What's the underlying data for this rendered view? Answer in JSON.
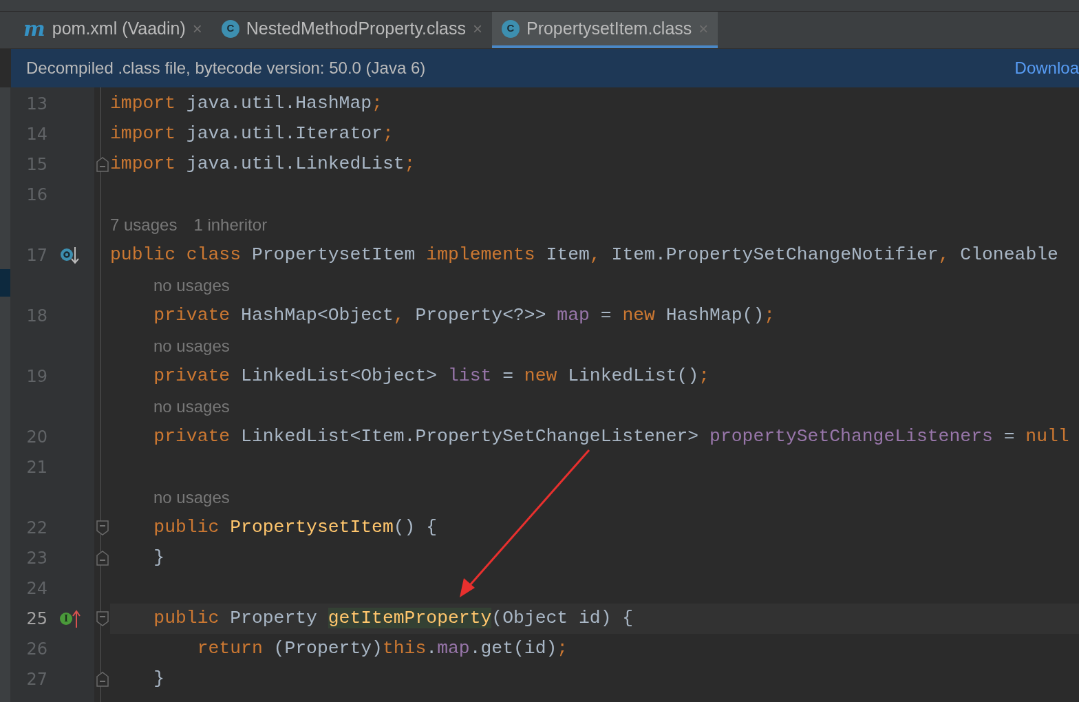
{
  "tabs": [
    {
      "kind": "maven",
      "badge": "m",
      "label": "pom.xml (Vaadin)",
      "close": "×",
      "selected": false
    },
    {
      "kind": "class",
      "badge": "C",
      "label": "NestedMethodProperty.class",
      "close": "×",
      "selected": false
    },
    {
      "kind": "class",
      "badge": "C",
      "label": "PropertysetItem.class",
      "close": "×",
      "selected": true
    }
  ],
  "banner": {
    "text": "Decompiled .class file, bytecode version: 50.0 (Java 6)",
    "link": "Downloa"
  },
  "lines": [
    {
      "kind": "code",
      "number": "13",
      "current": false,
      "tokens": [
        {
          "t": "import",
          "kind": "kw"
        },
        {
          "t": " java.util.HashMap",
          "kind": "plain"
        },
        {
          "t": ";",
          "kind": "kw"
        }
      ]
    },
    {
      "kind": "code",
      "number": "14",
      "current": false,
      "tokens": [
        {
          "t": "import",
          "kind": "kw"
        },
        {
          "t": " java.util.Iterator",
          "kind": "plain"
        },
        {
          "t": ";",
          "kind": "kw"
        }
      ]
    },
    {
      "kind": "code",
      "number": "15",
      "current": false,
      "fold": {
        "kind": "end"
      },
      "tokens": [
        {
          "t": "import",
          "kind": "kw"
        },
        {
          "t": " java.util.LinkedList",
          "kind": "plain"
        },
        {
          "t": ";",
          "kind": "kw"
        }
      ]
    },
    {
      "kind": "code",
      "number": "16",
      "current": false
    },
    {
      "kind": "class-hint",
      "hints": [
        "7 usages",
        "1 inheritor"
      ]
    },
    {
      "kind": "code",
      "number": "17",
      "current": false,
      "gutter": {
        "kind": "implemented"
      },
      "tokens": [
        {
          "t": "public class ",
          "kind": "kw"
        },
        {
          "t": "PropertysetItem ",
          "kind": "plain"
        },
        {
          "t": "implements ",
          "kind": "kw"
        },
        {
          "t": "Item",
          "kind": "plain"
        },
        {
          "t": ", ",
          "kind": "kw"
        },
        {
          "t": "Item.PropertySetChangeNotifier",
          "kind": "plain"
        },
        {
          "t": ", ",
          "kind": "kw"
        },
        {
          "t": "Cloneable",
          "kind": "plain"
        }
      ]
    },
    {
      "kind": "member-hint",
      "hints": [
        "no usages"
      ]
    },
    {
      "kind": "code",
      "number": "18",
      "current": false,
      "tokens": [
        {
          "t": "    private ",
          "kind": "kw"
        },
        {
          "t": "HashMap<Object",
          "kind": "plain"
        },
        {
          "t": ", ",
          "kind": "kw"
        },
        {
          "t": "Property<?>> ",
          "kind": "plain"
        },
        {
          "t": "map",
          "kind": "field"
        },
        {
          "t": " = ",
          "kind": "plain"
        },
        {
          "t": "new ",
          "kind": "kw"
        },
        {
          "t": "HashMap()",
          "kind": "plain"
        },
        {
          "t": ";",
          "kind": "kw"
        }
      ]
    },
    {
      "kind": "member-hint",
      "hints": [
        "no usages"
      ]
    },
    {
      "kind": "code",
      "number": "19",
      "current": false,
      "tokens": [
        {
          "t": "    private ",
          "kind": "kw"
        },
        {
          "t": "LinkedList<Object> ",
          "kind": "plain"
        },
        {
          "t": "list",
          "kind": "field"
        },
        {
          "t": " = ",
          "kind": "plain"
        },
        {
          "t": "new ",
          "kind": "kw"
        },
        {
          "t": "LinkedList()",
          "kind": "plain"
        },
        {
          "t": ";",
          "kind": "kw"
        }
      ]
    },
    {
      "kind": "member-hint",
      "hints": [
        "no usages"
      ]
    },
    {
      "kind": "code",
      "number": "20",
      "current": false,
      "tokens": [
        {
          "t": "    private ",
          "kind": "kw"
        },
        {
          "t": "LinkedList<Item.PropertySetChangeListener> ",
          "kind": "plain"
        },
        {
          "t": "propertySetChangeListeners",
          "kind": "field"
        },
        {
          "t": " = ",
          "kind": "plain"
        },
        {
          "t": "null",
          "kind": "kw"
        }
      ]
    },
    {
      "kind": "code",
      "number": "21",
      "current": false
    },
    {
      "kind": "member-hint",
      "hints": [
        "no usages"
      ]
    },
    {
      "kind": "code",
      "number": "22",
      "current": false,
      "fold": {
        "kind": "start"
      },
      "tokens": [
        {
          "t": "    public ",
          "kind": "kw"
        },
        {
          "t": "PropertysetItem",
          "kind": "decl"
        },
        {
          "t": "() {",
          "kind": "plain"
        }
      ]
    },
    {
      "kind": "code",
      "number": "23",
      "current": false,
      "fold": {
        "kind": "end"
      },
      "tokens": [
        {
          "t": "    }",
          "kind": "plain"
        }
      ]
    },
    {
      "kind": "code",
      "number": "24",
      "current": false
    },
    {
      "kind": "code",
      "number": "25",
      "current": true,
      "gutter": {
        "kind": "implements",
        "badge": "I"
      },
      "fold": {
        "kind": "start"
      },
      "tokens": [
        {
          "t": "    public ",
          "kind": "kw"
        },
        {
          "t": "Property ",
          "kind": "plain"
        },
        {
          "t": "getItemProperty",
          "kind": "decl-hl"
        },
        {
          "t": "(Object id) {",
          "kind": "plain"
        }
      ]
    },
    {
      "kind": "code",
      "number": "26",
      "current": false,
      "tokens": [
        {
          "t": "        return ",
          "kind": "kw"
        },
        {
          "t": "(Property)",
          "kind": "plain"
        },
        {
          "t": "this",
          "kind": "kw"
        },
        {
          "t": ".",
          "kind": "plain"
        },
        {
          "t": "map",
          "kind": "field"
        },
        {
          "t": ".get(id)",
          "kind": "plain"
        },
        {
          "t": ";",
          "kind": "kw"
        }
      ]
    },
    {
      "kind": "code",
      "number": "27",
      "current": false,
      "fold": {
        "kind": "end"
      },
      "tokens": [
        {
          "t": "    }",
          "kind": "plain"
        }
      ]
    }
  ]
}
